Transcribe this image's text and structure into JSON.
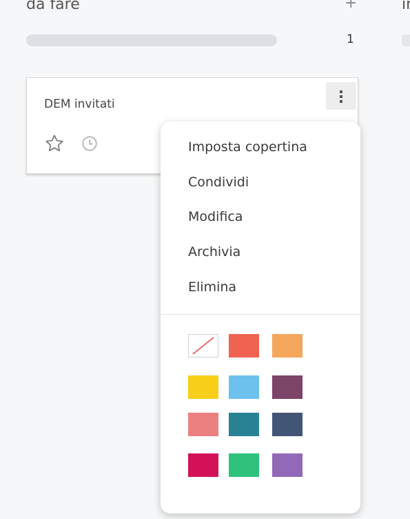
{
  "column": {
    "title": "da fare",
    "add_glyph": "+",
    "card_count": "1",
    "progress": 0,
    "next_title": "in"
  },
  "card": {
    "title": "DEM invitati",
    "icons": [
      "star-outline-icon",
      "clock-icon",
      "kebab-menu-icon"
    ]
  },
  "menu": {
    "items": [
      "Imposta copertina",
      "Condividi",
      "Modifica",
      "Archivia",
      "Elimina"
    ],
    "colors": [
      "none",
      "#ef6350",
      "#f4a65c",
      "#f7cf19",
      "#6dc1ed",
      "#7c4467",
      "#ec7f7f",
      "#288293",
      "#425577",
      "#d31159",
      "#2ec27d",
      "#9268b9"
    ]
  }
}
